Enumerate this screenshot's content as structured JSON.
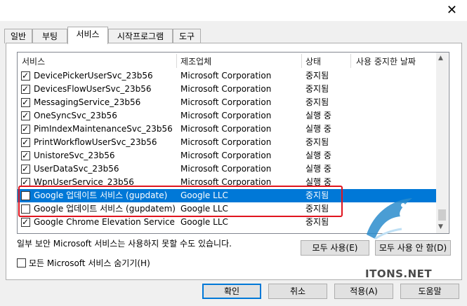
{
  "window": {
    "close_glyph": "✕"
  },
  "tabs": [
    {
      "label": "일반"
    },
    {
      "label": "부팅"
    },
    {
      "label": "서비스",
      "active": true
    },
    {
      "label": "시작프로그램"
    },
    {
      "label": "도구"
    }
  ],
  "columns": {
    "service": "서비스",
    "manufacturer": "제조업체",
    "status": "상태",
    "disabled_date": "사용 중지한 날짜"
  },
  "services": [
    {
      "name": "DevicePickerUserSvc_23b56",
      "maker": "Microsoft Corporation",
      "status": "중지됨",
      "checked": true
    },
    {
      "name": "DevicesFlowUserSvc_23b56",
      "maker": "Microsoft Corporation",
      "status": "중지됨",
      "checked": true
    },
    {
      "name": "MessagingService_23b56",
      "maker": "Microsoft Corporation",
      "status": "중지됨",
      "checked": true
    },
    {
      "name": "OneSyncSvc_23b56",
      "maker": "Microsoft Corporation",
      "status": "실행 중",
      "checked": true
    },
    {
      "name": "PimIndexMaintenanceSvc_23b56",
      "maker": "Microsoft Corporation",
      "status": "실행 중",
      "checked": true
    },
    {
      "name": "PrintWorkflowUserSvc_23b56",
      "maker": "Microsoft Corporation",
      "status": "중지됨",
      "checked": true
    },
    {
      "name": "UnistoreSvc_23b56",
      "maker": "Microsoft Corporation",
      "status": "실행 중",
      "checked": true
    },
    {
      "name": "UserDataSvc_23b56",
      "maker": "Microsoft Corporation",
      "status": "실행 중",
      "checked": true
    },
    {
      "name": "WpnUserService_23b56",
      "maker": "Microsoft Corporation",
      "status": "실행 중",
      "checked": true
    },
    {
      "name": "Google 업데이트 서비스 (gupdate)",
      "maker": "Google LLC",
      "status": "중지됨",
      "checked": false,
      "selected": true
    },
    {
      "name": "Google 업데이트 서비스 (gupdatem)",
      "maker": "Google LLC",
      "status": "중지됨",
      "checked": false
    },
    {
      "name": "Google Chrome Elevation Service",
      "maker": "Google LLC",
      "status": "중지됨",
      "checked": true
    }
  ],
  "note": "일부 보안 Microsoft 서비스는 사용하지 못할 수도 있습니다.",
  "buttons": {
    "enable_all": "모두 사용(E)",
    "disable_all": "모두 사용 안 함(D)",
    "ok": "확인",
    "cancel": "취소",
    "apply": "적용(A)",
    "help": "도움말"
  },
  "hide_ms_label": "모든 Microsoft 서비스 숨기기(H)",
  "watermark": "ITONS.NET",
  "colors": {
    "selection": "#0078d7",
    "highlight_box": "#e0141e"
  }
}
